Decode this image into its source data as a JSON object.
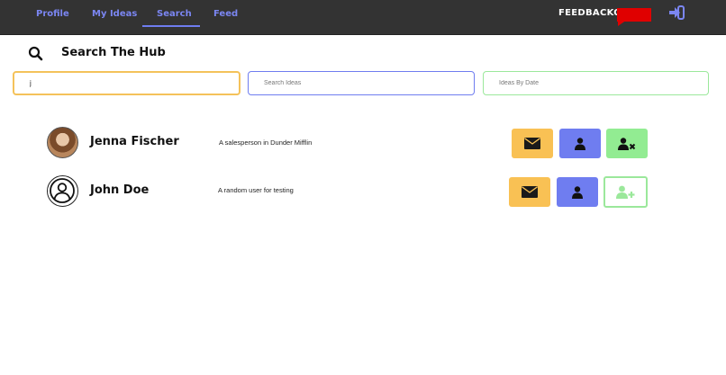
{
  "nav": {
    "items": [
      {
        "label": "Profile"
      },
      {
        "label": "My Ideas"
      },
      {
        "label": "Search"
      },
      {
        "label": "Feed"
      }
    ],
    "active": "Search",
    "brand": "FEEDBACKO"
  },
  "page": {
    "title": "Search The Hub"
  },
  "search": {
    "user_value": "j",
    "ideas_placeholder": "Search Ideas",
    "date_placeholder": "Ideas By Date"
  },
  "users": [
    {
      "name": "Jenna Fischer",
      "description": "A salesperson in Dunder Mifflin",
      "following": true
    },
    {
      "name": "John Doe",
      "description": "A random user for testing",
      "following": false
    }
  ],
  "colors": {
    "accent_blue": "#6f7df0",
    "accent_yellow": "#f9c154",
    "accent_green": "#92ec92",
    "brand_red": "#e00000",
    "topbar": "#333333"
  },
  "icons": {
    "search": "search-icon",
    "logout": "logout-icon",
    "mail": "envelope-icon",
    "profile": "user-icon",
    "unfollow": "user-remove-icon",
    "follow": "user-add-icon"
  }
}
